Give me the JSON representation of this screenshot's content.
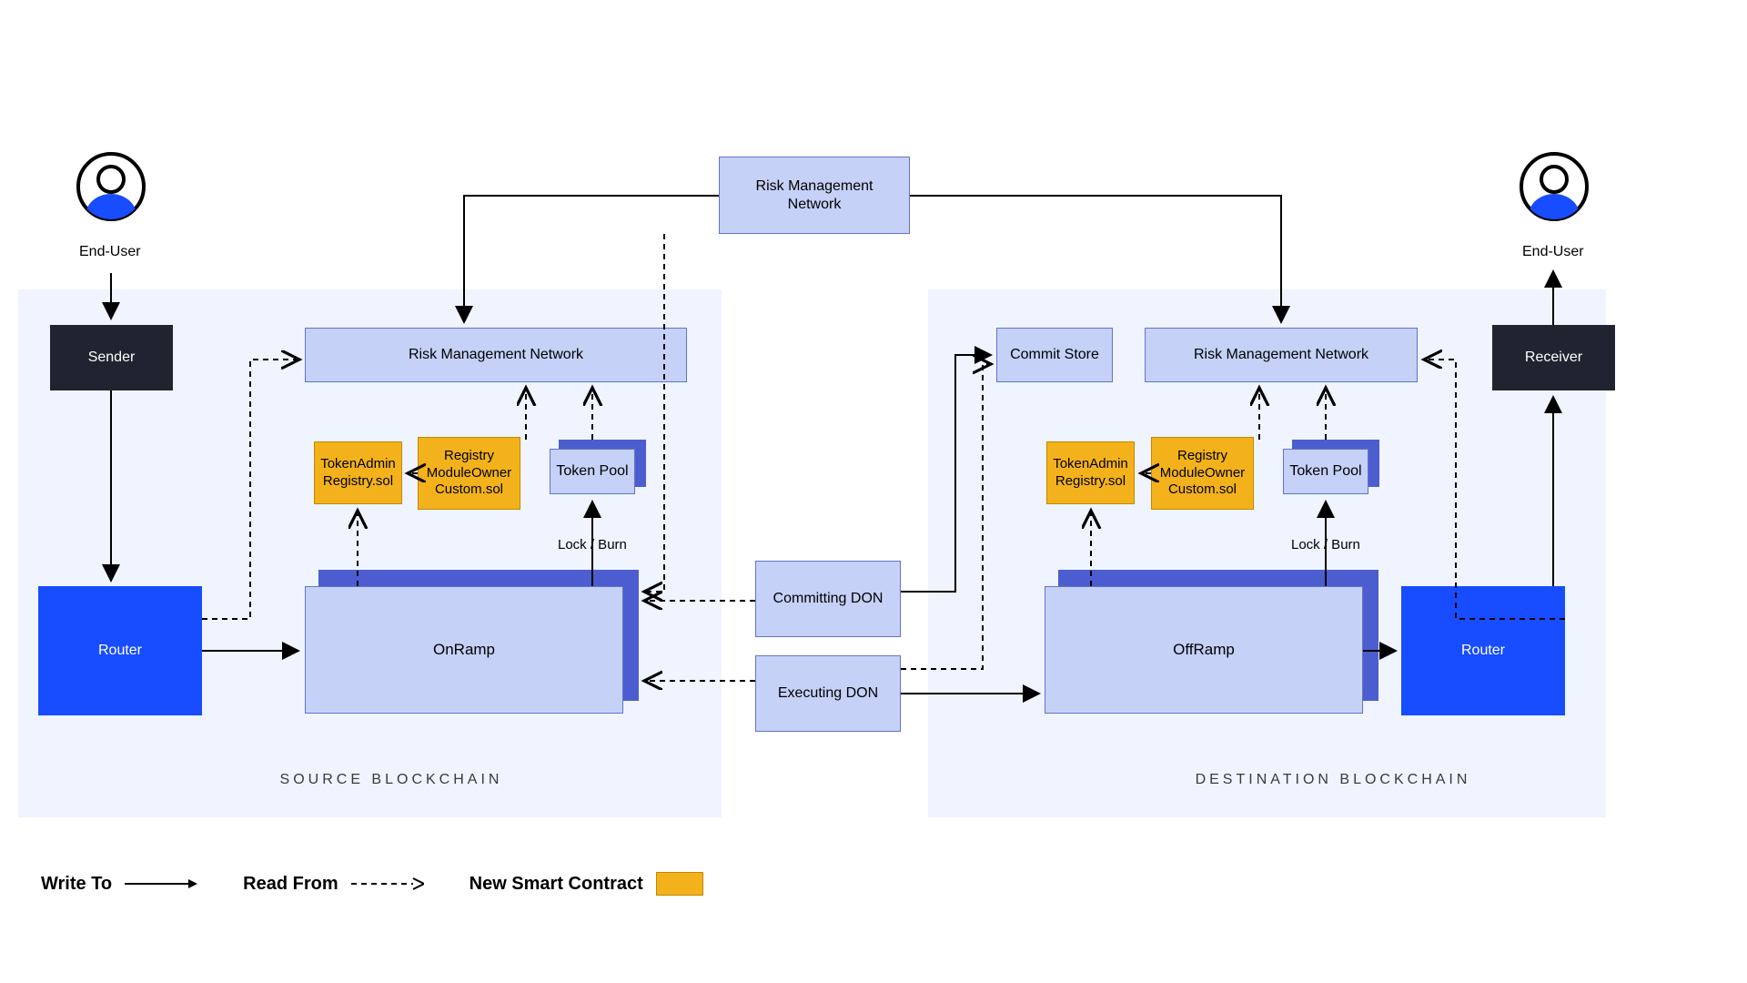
{
  "users": {
    "left_label": "End-User",
    "right_label": "End-User"
  },
  "source": {
    "panel_label": "SOURCE BLOCKCHAIN",
    "sender": "Sender",
    "router": "Router",
    "rmn": "Risk Management Network",
    "tokenAdmin": "TokenAdmin\nRegistry.sol",
    "registryModule": "Registry\nModuleOwner\nCustom.sol",
    "tokenPool": "Token Pool",
    "lockBurn": "Lock / Burn",
    "onRamp": "OnRamp"
  },
  "center": {
    "rmn_top": "Risk Management\nNetwork",
    "committing": "Committing DON",
    "executing": "Executing DON"
  },
  "dest": {
    "panel_label": "DESTINATION BLOCKCHAIN",
    "receiver": "Receiver",
    "router": "Router",
    "commitStore": "Commit Store",
    "rmn": "Risk Management Network",
    "tokenAdmin": "TokenAdmin\nRegistry.sol",
    "registryModule": "Registry\nModuleOwner\nCustom.sol",
    "tokenPool": "Token Pool",
    "lockBurn": "Lock / Burn",
    "offRamp": "OffRamp"
  },
  "legend": {
    "writeTo": "Write To",
    "readFrom": "Read From",
    "newContract": "New Smart Contract"
  },
  "colors": {
    "light": "#c5d1f7",
    "stroke": "#6373c9",
    "dark": "#1f2430",
    "blue": "#174cff",
    "orange": "#f3b21b",
    "panel": "#eff4ff",
    "arrow": "#000"
  }
}
